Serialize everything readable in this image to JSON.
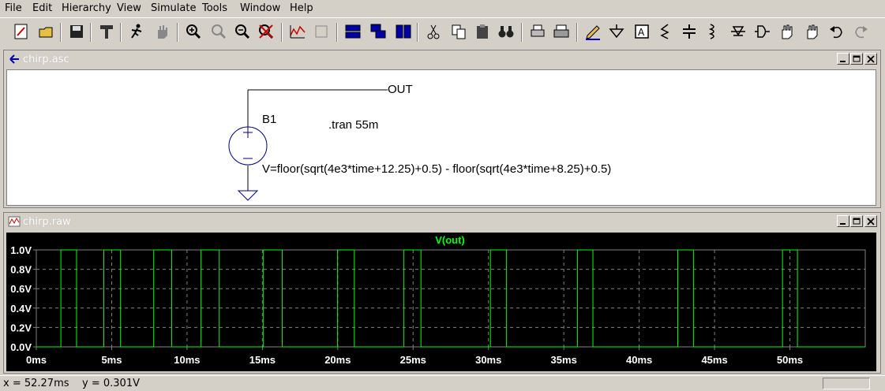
{
  "menu": [
    "File",
    "Edit",
    "Hierarchy",
    "View",
    "Simulate",
    "Tools",
    "Window",
    "Help"
  ],
  "toolbar_icons": [
    "new-schematic-icon",
    "open-icon",
    "save-icon",
    "control-panel-icon",
    "run-icon",
    "halt-icon",
    "zoom-in-icon",
    "zoom-pan-icon",
    "zoom-out-icon",
    "zoom-cancel-icon",
    "autorange-icon",
    "view-3d-icon",
    "tile-horizontal-icon",
    "cascade-icon",
    "tile-vertical-icon",
    "cut-icon",
    "copy-icon",
    "paste-icon",
    "find-icon",
    "print-preview-icon",
    "print-icon",
    "draw-wire-icon",
    "ground-icon",
    "label-net-icon",
    "resistor-icon",
    "capacitor-icon",
    "inductor-icon",
    "diode-icon",
    "component-icon",
    "move-icon",
    "drag-icon",
    "undo-icon",
    "redo-icon"
  ],
  "schematic": {
    "title": "chirp.asc",
    "net_label": "OUT",
    "component_name": "B1",
    "directive": ".tran 55m",
    "expression": "V=floor(sqrt(4e3*time+12.25)+0.5) - floor(sqrt(4e3*time+8.25)+0.5)"
  },
  "waveform": {
    "title": "chirp.raw",
    "trace_label": "V(out)"
  },
  "chart_data": {
    "type": "line",
    "title": "",
    "series": [
      {
        "name": "V(out)",
        "color": "#00ff00",
        "edges": [
          1.63,
          2.67,
          4.48,
          5.59,
          7.79,
          8.98,
          10.93,
          12.14,
          15.07,
          16.32,
          19.99,
          21.1,
          24.39,
          25.52,
          30.13,
          31.2,
          35.9,
          36.93,
          42.56,
          43.6,
          49.51,
          50.5
        ]
      }
    ],
    "xlabel": "",
    "ylabel": "",
    "xlim": [
      0,
      55
    ],
    "ylim": [
      0,
      1
    ],
    "x_ticks": [
      "0ms",
      "5ms",
      "10ms",
      "15ms",
      "20ms",
      "25ms",
      "30ms",
      "35ms",
      "40ms",
      "45ms",
      "50ms"
    ],
    "y_ticks": [
      "0.0V",
      "0.2V",
      "0.4V",
      "0.6V",
      "0.8V",
      "1.0V"
    ],
    "grid": true,
    "colors": {
      "background": "#000000",
      "trace": "#00ff00",
      "grid": "#808080",
      "labels": "#ffffff"
    }
  },
  "status": {
    "text": "x = 52.27ms    y = 0.301V"
  },
  "colors": {
    "schematic_wire": "#000080",
    "window_title_text": "#ffffff"
  }
}
